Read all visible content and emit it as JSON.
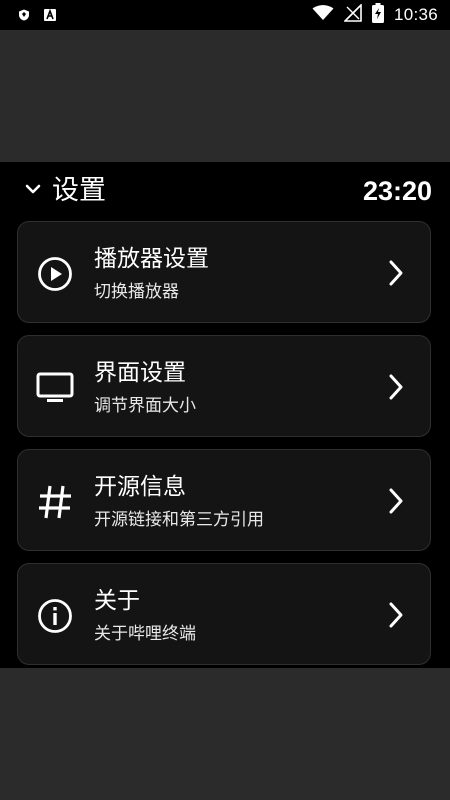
{
  "status_bar": {
    "left_icons": [
      "shield-icon",
      "app-a-icon"
    ],
    "right_icons": [
      "wifi-icon",
      "no-signal-icon",
      "battery-charging-icon"
    ],
    "time": "10:36"
  },
  "header": {
    "title": "设置",
    "time": "23:20"
  },
  "items": [
    {
      "title": "播放器设置",
      "subtitle": "切换播放器",
      "icon": "play-circle-icon"
    },
    {
      "title": "界面设置",
      "subtitle": "调节界面大小",
      "icon": "monitor-icon"
    },
    {
      "title": "开源信息",
      "subtitle": "开源链接和第三方引用",
      "icon": "hash-icon"
    },
    {
      "title": "关于",
      "subtitle": "关于哔哩终端",
      "icon": "info-icon"
    }
  ],
  "colors": {
    "background": "#2b2b2b",
    "panel": "#000000",
    "card": "#141414",
    "card_border": "#2f2f2f",
    "text": "#ffffff"
  }
}
